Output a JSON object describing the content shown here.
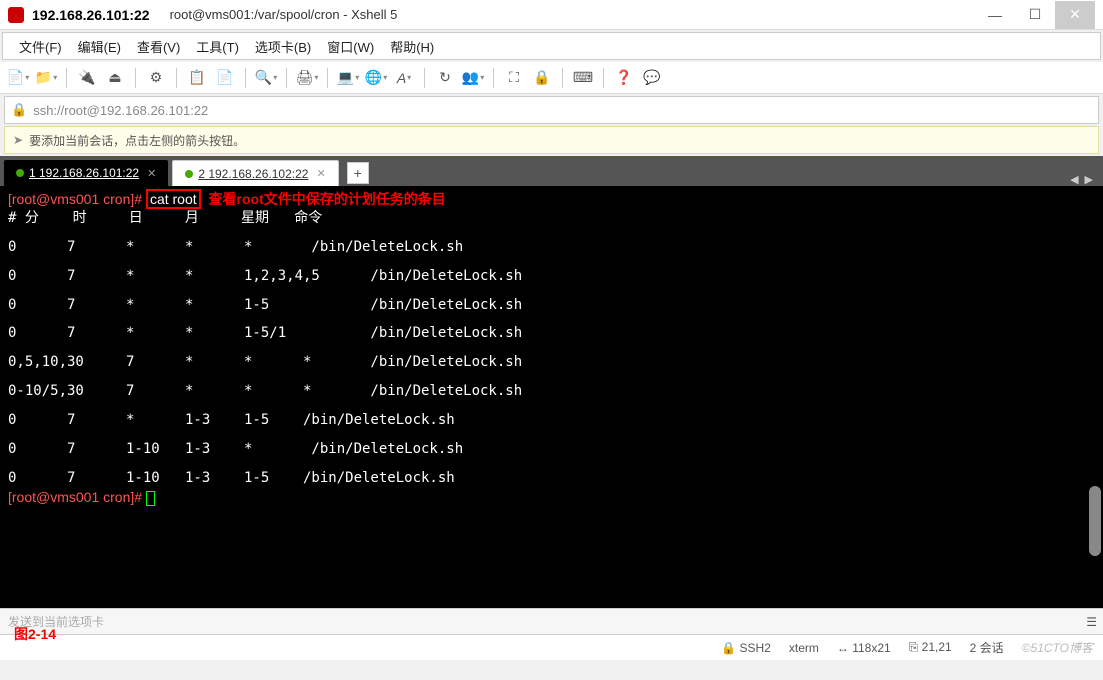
{
  "titlebar": {
    "ip": "192.168.26.101:22",
    "title": "root@vms001:/var/spool/cron - Xshell 5"
  },
  "menu": {
    "file": "文件(F)",
    "edit": "编辑(E)",
    "view": "查看(V)",
    "tools": "工具(T)",
    "tabs": "选项卡(B)",
    "window": "窗口(W)",
    "help": "帮助(H)"
  },
  "addressbar": {
    "url": "ssh://root@192.168.26.101:22"
  },
  "infobar": {
    "msg": "要添加当前会话，点击左侧的箭头按钮。"
  },
  "tabs": {
    "t1": "1 192.168.26.101:22",
    "t2": "2 192.168.26.102:22"
  },
  "terminal": {
    "prompt1": "[root@vms001 cron]#",
    "cmd": "cat root",
    "note": "查看root文件中保存的计划任务的条目",
    "header": "# 分    时     日     月     星期   命令",
    "rows": [
      "0      7      *      *      *       /bin/DeleteLock.sh",
      "0      7      *      *      1,2,3,4,5      /bin/DeleteLock.sh",
      "0      7      *      *      1-5            /bin/DeleteLock.sh",
      "0      7      *      *      1-5/1          /bin/DeleteLock.sh",
      "0,5,10,30     7      *      *      *       /bin/DeleteLock.sh",
      "0-10/5,30     7      *      *      *       /bin/DeleteLock.sh",
      "0      7      *      1-3    1-5    /bin/DeleteLock.sh",
      "0      7      1-10   1-3    *       /bin/DeleteLock.sh",
      "0      7      1-10   1-3    1-5    /bin/DeleteLock.sh"
    ],
    "prompt2": "[root@vms001 cron]#"
  },
  "figlabel": "图2-14",
  "sendbar": {
    "text": "发送到当前选项卡"
  },
  "status": {
    "ssh": "SSH2",
    "term": "xterm",
    "size": "118x21",
    "pos": "21,21",
    "sess": "2 会话",
    "watermark": "©51CTO博客"
  }
}
